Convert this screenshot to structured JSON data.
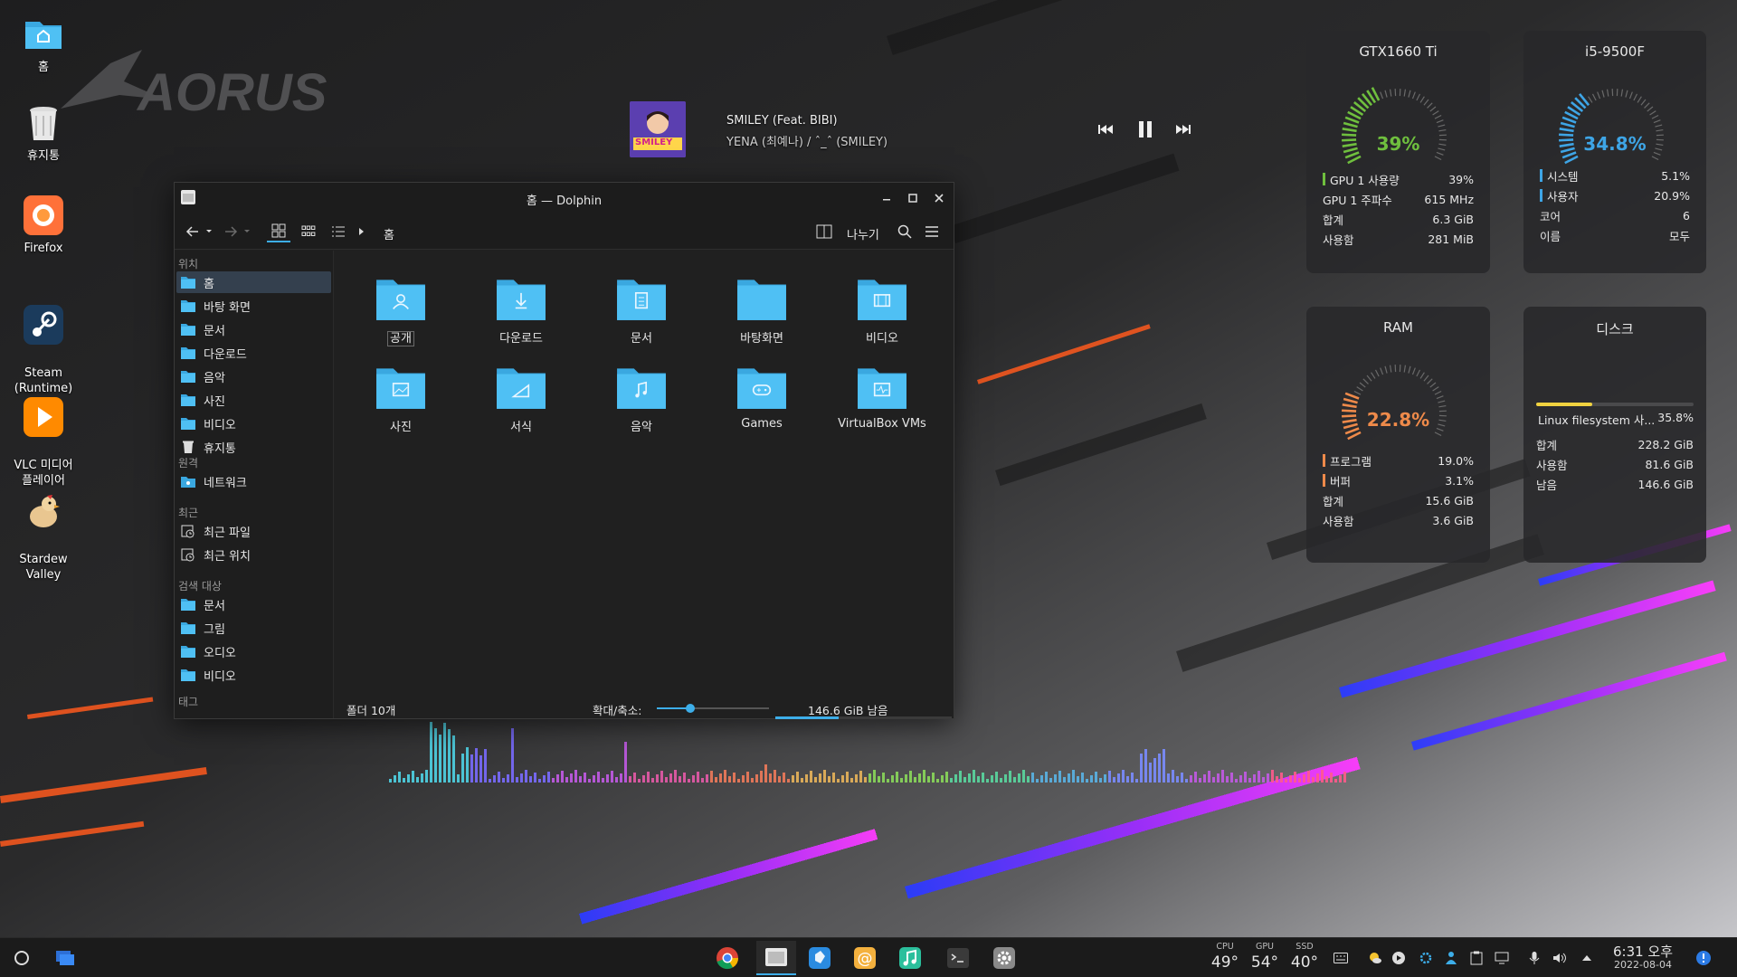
{
  "desktop": {
    "icons": [
      {
        "label": "홈",
        "icon": "home-folder-icon"
      },
      {
        "label": "휴지통",
        "icon": "trash-icon"
      },
      {
        "label": "Firefox",
        "icon": "firefox-icon"
      },
      {
        "label": "Steam\n(Runtime)",
        "icon": "steam-icon"
      },
      {
        "label": "VLC 미디어\n플레이어",
        "icon": "vlc-icon"
      },
      {
        "label": "Stardew\nValley",
        "icon": "stardew-icon"
      }
    ],
    "logo_text": "AORUS"
  },
  "media_player": {
    "title": "SMILEY (Feat. BIBI)",
    "artist": "YENA (최예나) / ˆ_ˆ (SMILEY)",
    "album_text": "SMILEY",
    "state": "playing"
  },
  "widgets": {
    "gpu": {
      "title": "GTX1660 Ti",
      "value": "39%",
      "fraction": 0.39,
      "color": "#6fbf3e",
      "rows": [
        {
          "label": "GPU 1 사용량",
          "value": "39%",
          "bar": "#6fbf3e"
        },
        {
          "label": "GPU 1 주파수",
          "value": "615 MHz",
          "bar": ""
        },
        {
          "label": "합계",
          "value": "6.3 GiB",
          "bar": ""
        },
        {
          "label": "사용함",
          "value": "281 MiB",
          "bar": ""
        }
      ]
    },
    "cpu": {
      "title": "i5-9500F",
      "value": "34.8%",
      "fraction": 0.348,
      "color": "#3ea5e6",
      "rows": [
        {
          "label": "시스템",
          "value": "5.1%",
          "bar": "#3ea5e6"
        },
        {
          "label": "사용자",
          "value": "20.9%",
          "bar": "#3ea5e6"
        },
        {
          "label": "코어",
          "value": "6",
          "bar": ""
        },
        {
          "label": "이름",
          "value": "모두",
          "bar": ""
        }
      ]
    },
    "ram": {
      "title": "RAM",
      "value": "22.8%",
      "fraction": 0.228,
      "color": "#ee8a4a",
      "rows": [
        {
          "label": "프로그램",
          "value": "19.0%",
          "bar": "#ee8a4a"
        },
        {
          "label": "버퍼",
          "value": "3.1%",
          "bar": "#ee8a4a"
        },
        {
          "label": "합계",
          "value": "15.6 GiB",
          "bar": ""
        },
        {
          "label": "사용함",
          "value": "3.6 GiB",
          "bar": ""
        }
      ]
    },
    "disk": {
      "title": "디스크",
      "fs_label": "Linux filesystem 사...",
      "fs_value": "35.8%",
      "fraction": 0.358,
      "color": "#f0d240",
      "rows": [
        {
          "label": "합계",
          "value": "228.2 GiB"
        },
        {
          "label": "사용함",
          "value": "81.6 GiB"
        },
        {
          "label": "남음",
          "value": "146.6 GiB"
        }
      ]
    }
  },
  "dolphin": {
    "title": "홈 — Dolphin",
    "breadcrumb": "홈",
    "split_label": "나누기",
    "sidebar": {
      "sections": [
        "위치",
        "원격",
        "최근",
        "검색 대상",
        "태그"
      ],
      "places": [
        "홈",
        "바탕 화면",
        "문서",
        "다운로드",
        "음악",
        "사진",
        "비디오",
        "휴지통"
      ],
      "remote": [
        "네트워크"
      ],
      "recent": [
        "최근 파일",
        "최근 위치"
      ],
      "search": [
        "문서",
        "그림",
        "오디오",
        "비디오"
      ]
    },
    "folders": [
      {
        "name": "공개",
        "icon": "public-folder-icon"
      },
      {
        "name": "다운로드",
        "icon": "downloads-folder-icon"
      },
      {
        "name": "문서",
        "icon": "documents-folder-icon"
      },
      {
        "name": "바탕화면",
        "icon": "desktop-folder-icon"
      },
      {
        "name": "비디오",
        "icon": "videos-folder-icon"
      },
      {
        "name": "사진",
        "icon": "pictures-folder-icon"
      },
      {
        "name": "서식",
        "icon": "templates-folder-icon"
      },
      {
        "name": "음악",
        "icon": "music-folder-icon"
      },
      {
        "name": "Games",
        "icon": "games-folder-icon"
      },
      {
        "name": "VirtualBox VMs",
        "icon": "virtualbox-folder-icon"
      }
    ],
    "status": {
      "folder_count": "폴더 10개",
      "zoom_label": "확대/축소:",
      "zoom_fraction": 0.3,
      "free_space": "146.6 GiB 남음",
      "free_fraction": 0.36
    }
  },
  "taskbar": {
    "sensors": [
      {
        "label": "CPU",
        "value": "49°"
      },
      {
        "label": "GPU",
        "value": "54°"
      },
      {
        "label": "SSD",
        "value": "40°"
      }
    ],
    "clock_time": "6:31 오후",
    "clock_date": "2022-08-04"
  },
  "colors": {
    "accent": "#3daee9",
    "folder": "#3aa8e0"
  }
}
